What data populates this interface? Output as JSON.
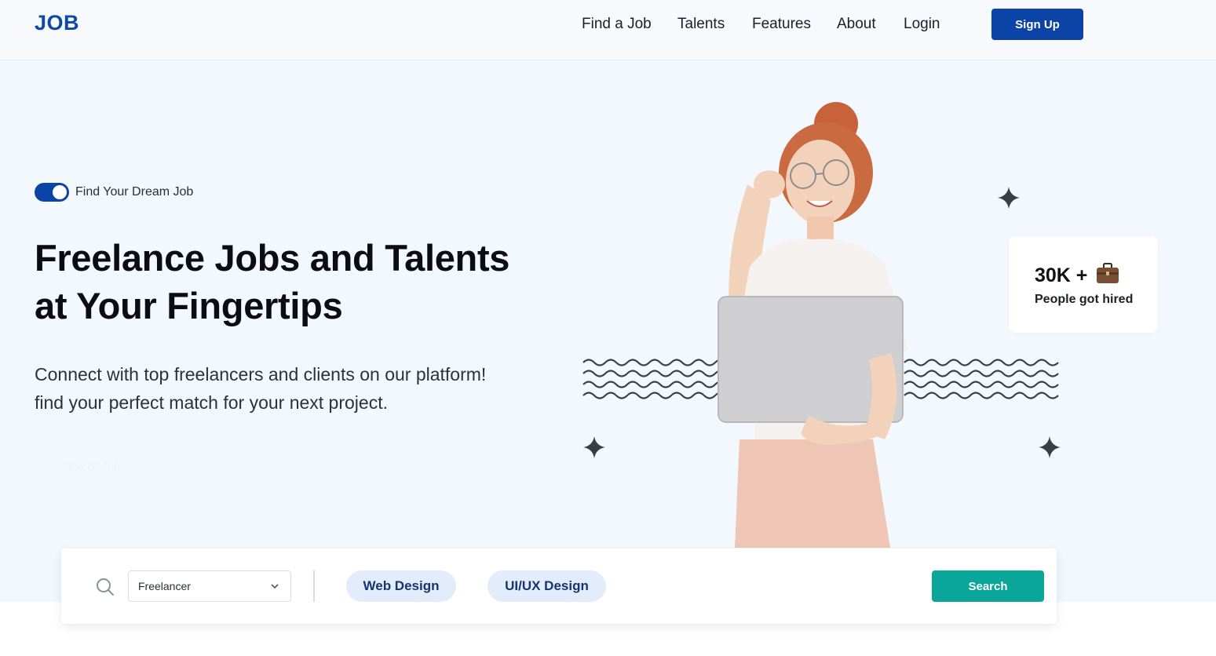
{
  "nav": {
    "logo": "JOB",
    "links": [
      "Find a Job",
      "Talents",
      "Features",
      "About",
      "Login"
    ],
    "signup": "Sign Up",
    "brand_color": "#0b44a6"
  },
  "hero": {
    "toggle_label": "Find Your Dream Job",
    "headline_line1": "Freelance Jobs and Talents",
    "headline_line2": "at Your Fingertips",
    "sub_line1": "Connect with top freelancers and clients on our platform!",
    "sub_line2": "find your perfect match for your next project.",
    "ghost_button": "View All Jobs",
    "stat_value": "30K +",
    "stat_icon": "briefcase-icon",
    "stat_label": "People got hired"
  },
  "search": {
    "select_value": "Freelancer",
    "chips": [
      "Web Design",
      "UI/UX Design"
    ],
    "button": "Search",
    "button_color": "#0aa69a"
  }
}
